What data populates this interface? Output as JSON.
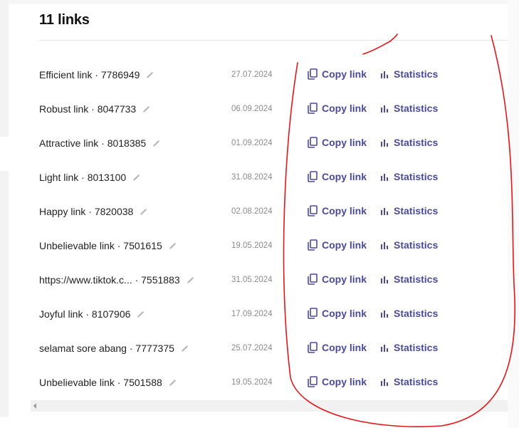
{
  "header": {
    "title": "11 links"
  },
  "links": [
    {
      "name": "Efficient link · 7786949",
      "date": "27.07.2024",
      "copy_label": "Copy link",
      "stats_label": "Statistics"
    },
    {
      "name": "Robust link · 8047733",
      "date": "06.09.2024",
      "copy_label": "Copy link",
      "stats_label": "Statistics"
    },
    {
      "name": "Attractive link · 8018385",
      "date": "01.09.2024",
      "copy_label": "Copy link",
      "stats_label": "Statistics"
    },
    {
      "name": "Light link · 8013100",
      "date": "31.08.2024",
      "copy_label": "Copy link",
      "stats_label": "Statistics"
    },
    {
      "name": "Happy link · 7820038",
      "date": "02.08.2024",
      "copy_label": "Copy link",
      "stats_label": "Statistics"
    },
    {
      "name": "Unbelievable link · 7501615",
      "date": "19.05.2024",
      "copy_label": "Copy link",
      "stats_label": "Statistics"
    },
    {
      "name": "https://www.tiktok.c... · 7551883",
      "date": "31.05.2024",
      "copy_label": "Copy link",
      "stats_label": "Statistics"
    },
    {
      "name": "Joyful link · 8107906",
      "date": "17.09.2024",
      "copy_label": "Copy link",
      "stats_label": "Statistics"
    },
    {
      "name": "selamat sore abang · 7777375",
      "date": "25.07.2024",
      "copy_label": "Copy link",
      "stats_label": "Statistics"
    },
    {
      "name": "Unbelievable link · 7501588",
      "date": "19.05.2024",
      "copy_label": "Copy link",
      "stats_label": "Statistics"
    }
  ],
  "icons": {
    "edit": "pencil-icon",
    "copy": "copy-icon",
    "stats": "bar-chart-icon",
    "scroll": "scroll-left-arrow-icon"
  },
  "colors": {
    "action": "#4a4a9a",
    "annotation": "#e3161b",
    "date": "#8a8a8a"
  }
}
